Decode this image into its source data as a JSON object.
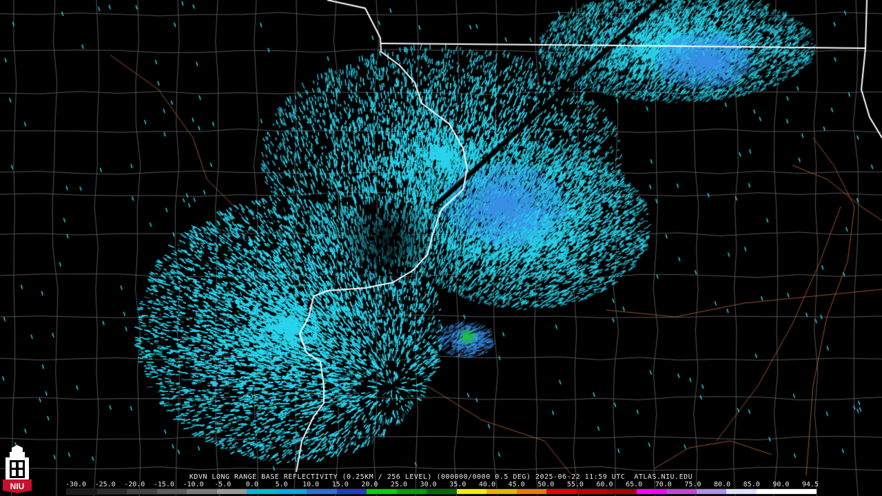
{
  "product_title": "KDVN LONG RANGE BASE REFLECTIVITY (0.25KM / 256 LEVEL) (000000/0000 0.5 DEG) 2025-06-22 11:59 UTC  ATLAS.NIU.EDU",
  "logo": {
    "text": "NIU",
    "icon": "university-tower-icon",
    "colors": {
      "red": "#c8102e",
      "white": "#ffffff"
    }
  },
  "color_scale": {
    "labels": [
      "-30.0",
      "-25.0",
      "-20.0",
      "-15.0",
      "-10.0",
      "-5.0",
      "0.0",
      "5.0",
      "10.0",
      "15.0",
      "20.0",
      "25.0",
      "30.0",
      "35.0",
      "40.0",
      "45.0",
      "50.0",
      "55.0",
      "60.0",
      "65.0",
      "70.0",
      "75.0",
      "80.0",
      "85.0",
      "90.0",
      "94.5"
    ],
    "colors": [
      "#1a1a1a",
      "#2c2c2c",
      "#444444",
      "#5e5e5e",
      "#7a7a7a",
      "#999999",
      "#00b8d0",
      "#00a8e8",
      "#2a6ee0",
      "#1c3ec8",
      "#00d000",
      "#00a000",
      "#006c00",
      "#f0f000",
      "#e8b400",
      "#f07800",
      "#e80000",
      "#c00000",
      "#a80000",
      "#ff00ff",
      "#c048d8",
      "#b090f0",
      "#e0e0ff",
      "#ffffff",
      "#ffffff"
    ]
  },
  "map_colors": {
    "background": "#000000",
    "county_lines": "#555555",
    "state_lines": "#ffffff",
    "roads": "#a0522d",
    "echo_cyan": "#2ad4ec",
    "echo_blue": "#3a8fe6",
    "echo_green": "#22c03a"
  }
}
